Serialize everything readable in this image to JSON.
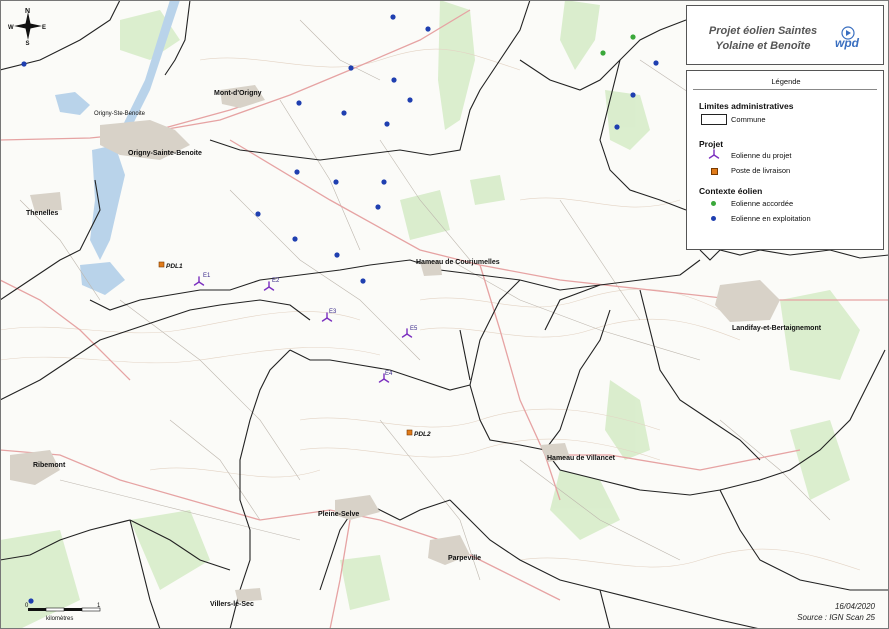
{
  "title": {
    "line1": "Projet éolien Saintes",
    "line2": "Yolaine et Benoîte",
    "logo_text": "wpd"
  },
  "legend": {
    "title": "Légende",
    "sections": [
      {
        "heading": "Limites administratives",
        "items": [
          {
            "label": "Commune",
            "symbol": "commune-box"
          }
        ]
      },
      {
        "heading": "Projet",
        "items": [
          {
            "label": "Eolienne du projet",
            "symbol": "turbine-icon"
          },
          {
            "label": "Poste de livraison",
            "symbol": "square-orange"
          }
        ]
      },
      {
        "heading": "Contexte éolien",
        "items": [
          {
            "label": "Eolienne accordée",
            "symbol": "dot-green"
          },
          {
            "label": "Eolienne en exploitation",
            "symbol": "dot-blue"
          }
        ]
      }
    ]
  },
  "colors": {
    "project": "#7b2fbf",
    "accorded": "#3aa83a",
    "operating": "#1f3fb0",
    "pdl": "#e07b1a",
    "commune_border": "#222222",
    "road": "#e8a0a0",
    "water": "#b9d3ea",
    "forest": "#cfe8c1"
  },
  "places": {
    "origny": "Origny-Sainte-Benoite",
    "origny_water": "Origny-Ste-Benoite",
    "mont_origny": "Mont-d'Origny",
    "thenelles": "Thenelles",
    "courjumelles": "Hameau de Courjumelles",
    "landifay": "Landifay-et-Bertaignemont",
    "ribemont": "Ribemont",
    "villancet": "Hameau de Villancet",
    "pleine_selve": "Pleine-Selve",
    "parpeville": "Parpeville",
    "villers": "Villers-le-Sec"
  },
  "turbines": [
    "E1",
    "E2",
    "E3",
    "E4",
    "E5"
  ],
  "pdl": [
    "PDL1",
    "PDL2"
  ],
  "compass": {
    "n": "N",
    "s": "S",
    "e": "E",
    "w": "W"
  },
  "scale": {
    "zero": "0",
    "one": "1",
    "unit": "kilomètres"
  },
  "footer": {
    "date": "16/04/2020",
    "source": "Source : IGN Scan 25"
  }
}
